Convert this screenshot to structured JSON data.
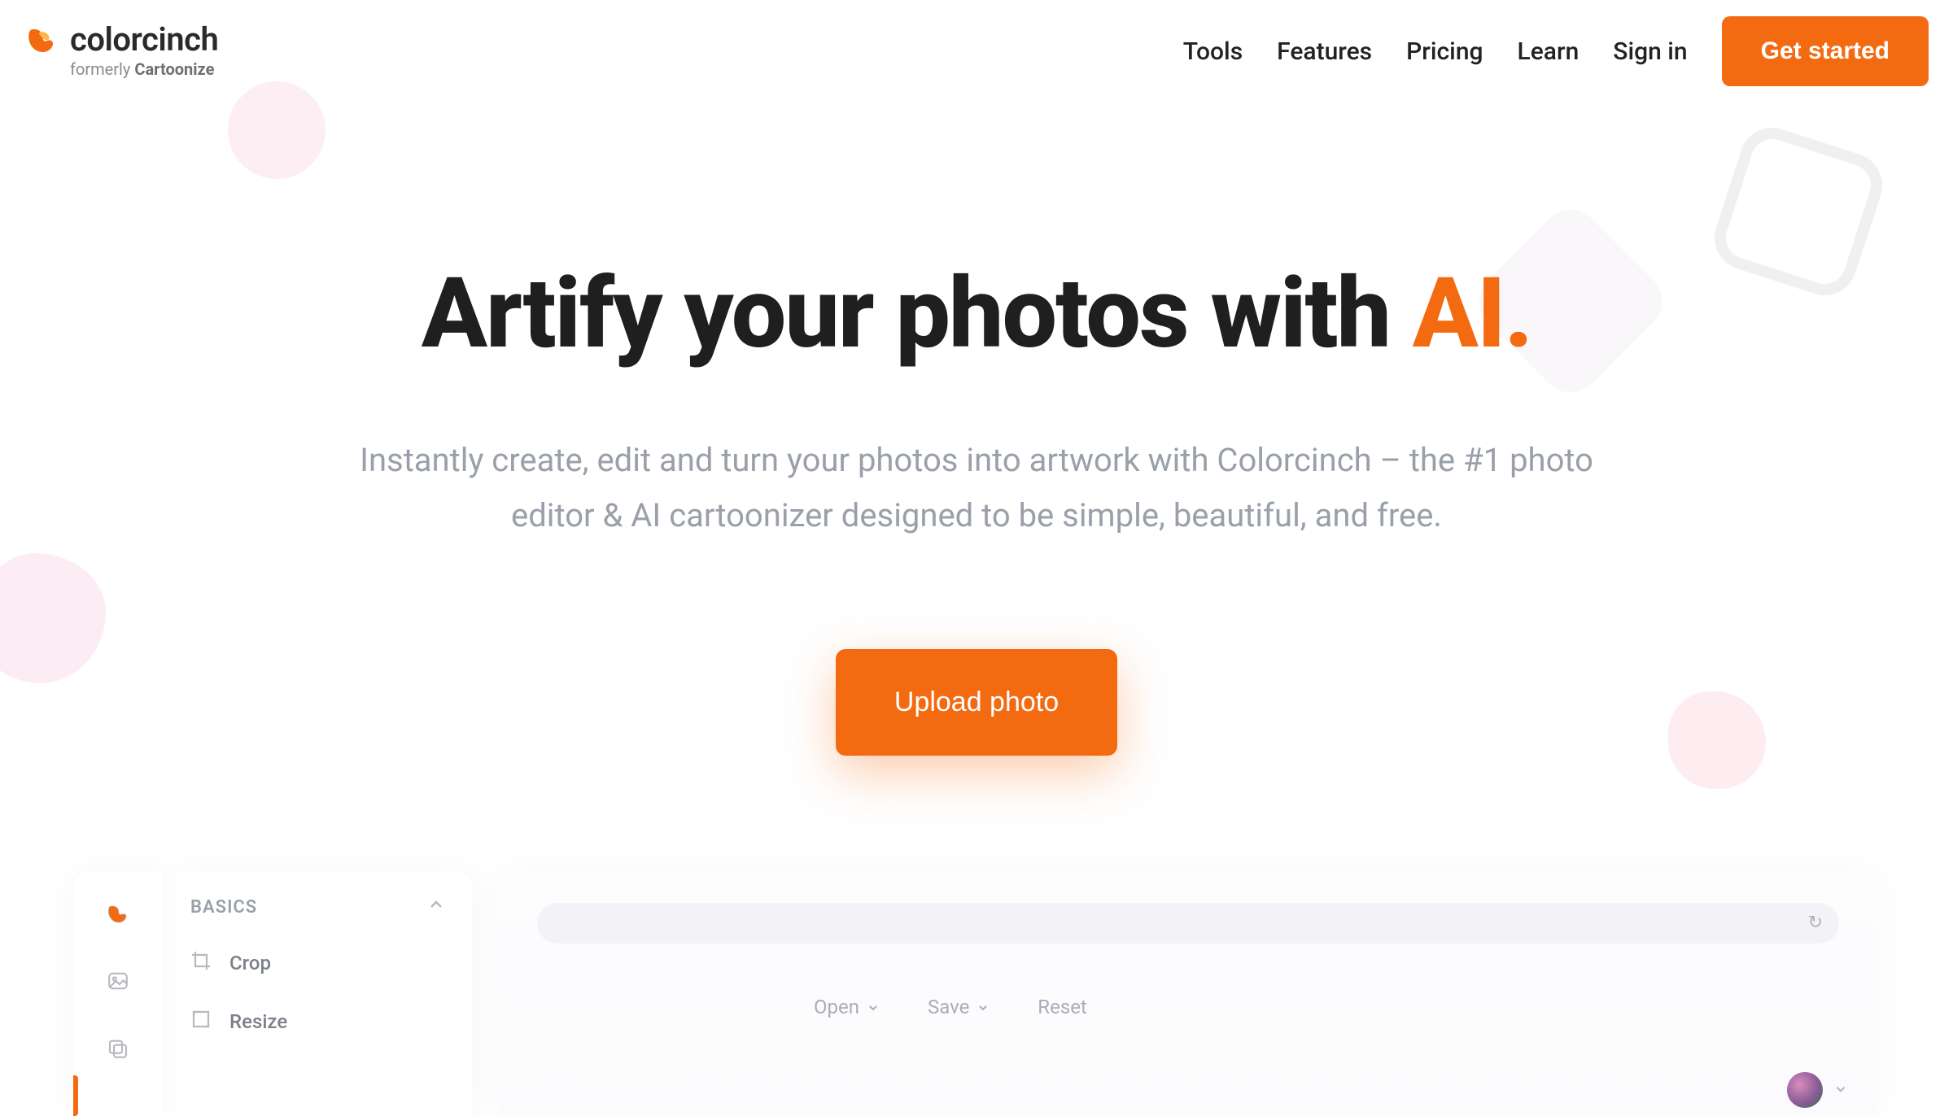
{
  "header": {
    "brand_name": "colorcinch",
    "brand_sub_prefix": "formerly ",
    "brand_sub_strong": "Cartoonize",
    "nav": {
      "tools": "Tools",
      "features": "Features",
      "pricing": "Pricing",
      "learn": "Learn",
      "signin": "Sign in",
      "get_started": "Get started"
    }
  },
  "hero": {
    "title_main": "Artify your photos with ",
    "title_accent": "AI.",
    "subtitle": "Instantly create, edit and turn your photos into artwork with Colorcinch – the #1 photo editor & AI cartoonizer designed to be simple, beautiful, and free.",
    "upload_button": "Upload photo"
  },
  "app_preview": {
    "panel_title": "BASICS",
    "items": {
      "crop": "Crop",
      "resize": "Resize"
    },
    "canvas_actions": {
      "open": "Open",
      "save": "Save",
      "reset": "Reset"
    }
  }
}
